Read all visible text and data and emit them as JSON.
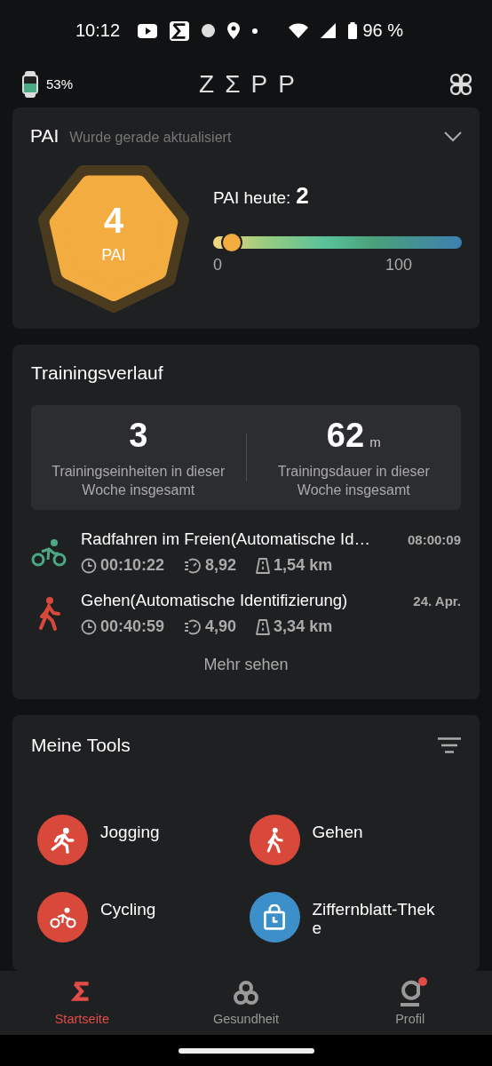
{
  "status_bar": {
    "time": "10:12",
    "battery": "96 %"
  },
  "header": {
    "watch_battery": "53%",
    "logo": "ZΣPP"
  },
  "pai_card": {
    "title": "PAI",
    "subtitle": "Wurde gerade aktualisiert",
    "score": "4",
    "score_unit": "PAI",
    "today_label": "PAI heute:",
    "today_value": "2",
    "level": 0.04,
    "scale_min": "0",
    "scale_max": "100"
  },
  "training": {
    "title": "Trainingsverlauf",
    "summary": [
      {
        "value": "3",
        "label": "Trainingseinheiten in dieser Woche insgesamt"
      },
      {
        "value": "62",
        "unit": "m",
        "label": "Trainingsdauer in dieser Woche insgesamt"
      }
    ],
    "activities": [
      {
        "kind": "cycling",
        "name": "Radfahren im Freien(Automatische Id…",
        "time": "08:00:09",
        "duration": "00:10:22",
        "pace": "8,92",
        "distance": "1,54 km"
      },
      {
        "kind": "walking",
        "name": "Gehen(Automatische Identifizierung)",
        "time": "24. Apr.",
        "duration": "00:40:59",
        "pace": "4,90",
        "distance": "3,34 km"
      }
    ],
    "more": "Mehr sehen"
  },
  "tools": {
    "title": "Meine Tools",
    "items": [
      {
        "kind": "running",
        "label": "Jogging"
      },
      {
        "kind": "walking",
        "label": "Gehen"
      },
      {
        "kind": "cycling",
        "label": "Cycling"
      },
      {
        "kind": "store",
        "label": "Ziffernblatt-Theke"
      }
    ]
  },
  "nav": [
    {
      "kind": "home",
      "label": "Startseite",
      "selected": true,
      "notification": false
    },
    {
      "kind": "health",
      "label": "Gesundheit",
      "selected": false,
      "notification": false
    },
    {
      "kind": "profile",
      "label": "Profil",
      "selected": false,
      "notification": true
    }
  ]
}
